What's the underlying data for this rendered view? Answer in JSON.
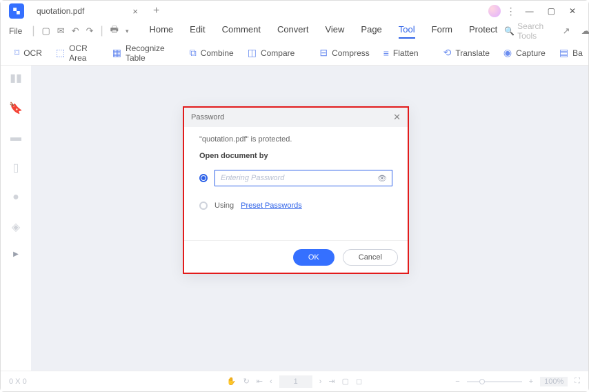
{
  "titlebar": {
    "tab_label": "quotation.pdf"
  },
  "menubar": {
    "file": "File",
    "items": [
      "Home",
      "Edit",
      "Comment",
      "Convert",
      "View",
      "Page",
      "Tool",
      "Form",
      "Protect"
    ],
    "active_index": 6,
    "search_placeholder": "Search Tools"
  },
  "toolbar": {
    "ocr": "OCR",
    "ocr_area": "OCR Area",
    "recognize_table": "Recognize Table",
    "combine": "Combine",
    "compare": "Compare",
    "compress": "Compress",
    "flatten": "Flatten",
    "translate": "Translate",
    "capture": "Capture",
    "batch": "Ba"
  },
  "dialog": {
    "title": "Password",
    "message": "\"quotation.pdf\" is protected.",
    "subheading": "Open document by",
    "password_placeholder": "Entering Password",
    "using_label": "Using",
    "preset_link": "Preset Passwords",
    "ok": "OK",
    "cancel": "Cancel"
  },
  "statusbar": {
    "dimensions": "0 X 0",
    "page": "1",
    "zoom": "100%"
  }
}
